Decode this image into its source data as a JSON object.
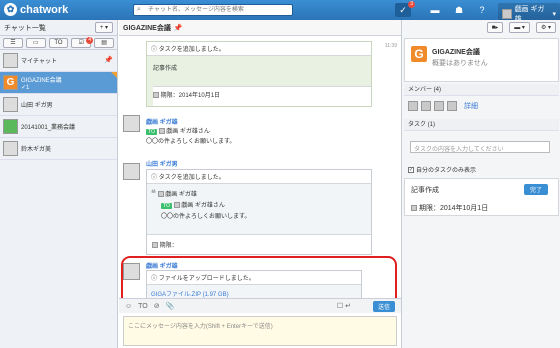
{
  "app": {
    "name": "chatwork"
  },
  "topbar": {
    "search_placeholder": "チャット名、メッセージ内容を検索",
    "notification_count": "3",
    "user_name": "戯画 ギガ雄"
  },
  "sidebar": {
    "title": "チャット一覧",
    "add_label": "+ ▾",
    "filter_badge": "4",
    "rooms": [
      {
        "name": "マイチャット",
        "sub": ""
      },
      {
        "name": "GIGAZINE会議",
        "sub": "✓1"
      },
      {
        "name": "山田 ギガ男",
        "sub": ""
      },
      {
        "name": "20141001_業務会議",
        "sub": ""
      },
      {
        "name": "鈴木ギガ美",
        "sub": ""
      }
    ]
  },
  "room": {
    "title": "GIGAZINE会議"
  },
  "messages": {
    "m1": {
      "system": "タスクを追加しました。",
      "task": "記事作成",
      "due": "期限：2014年10月1日",
      "time": "11:39"
    },
    "m2": {
      "name": "戯画 ギガ雄",
      "to_label": "TO",
      "to_name": "戯画 ギガ雄さん",
      "body": "〇〇の件よろしくお願いします。"
    },
    "m3": {
      "name": "山田 ギガ男",
      "system": "タスクを追加しました。",
      "quote_name": "戯画 ギガ雄",
      "to_label": "TO",
      "to_name": "戯画 ギガ雄さん",
      "body": "〇〇の件よろしくお願いします。",
      "due": "期限："
    },
    "m4": {
      "name": "戯画 ギガ雄",
      "system": "ファイルをアップロードしました。",
      "file": "GIGAファイル.ZIP (1.97 GB)"
    }
  },
  "compose": {
    "placeholder": "ここにメッセージ内容を入力(Shift + Enterキーで送信)",
    "send_label": "送信",
    "toolbar_icons": [
      "☺",
      "TO",
      "⊘",
      "📎"
    ]
  },
  "right": {
    "room_name": "GIGAZINE会議",
    "room_sub": "概要はありません",
    "members_label": "メンバー (4)",
    "detail_label": "詳細",
    "task_label": "タスク (1)",
    "task_placeholder": "タスクの内容を入力してください",
    "own_only_label": "自分のタスクのみ表示",
    "task_title": "記事作成",
    "task_due": "期限：2014年10月1日",
    "done_label": "完了"
  }
}
